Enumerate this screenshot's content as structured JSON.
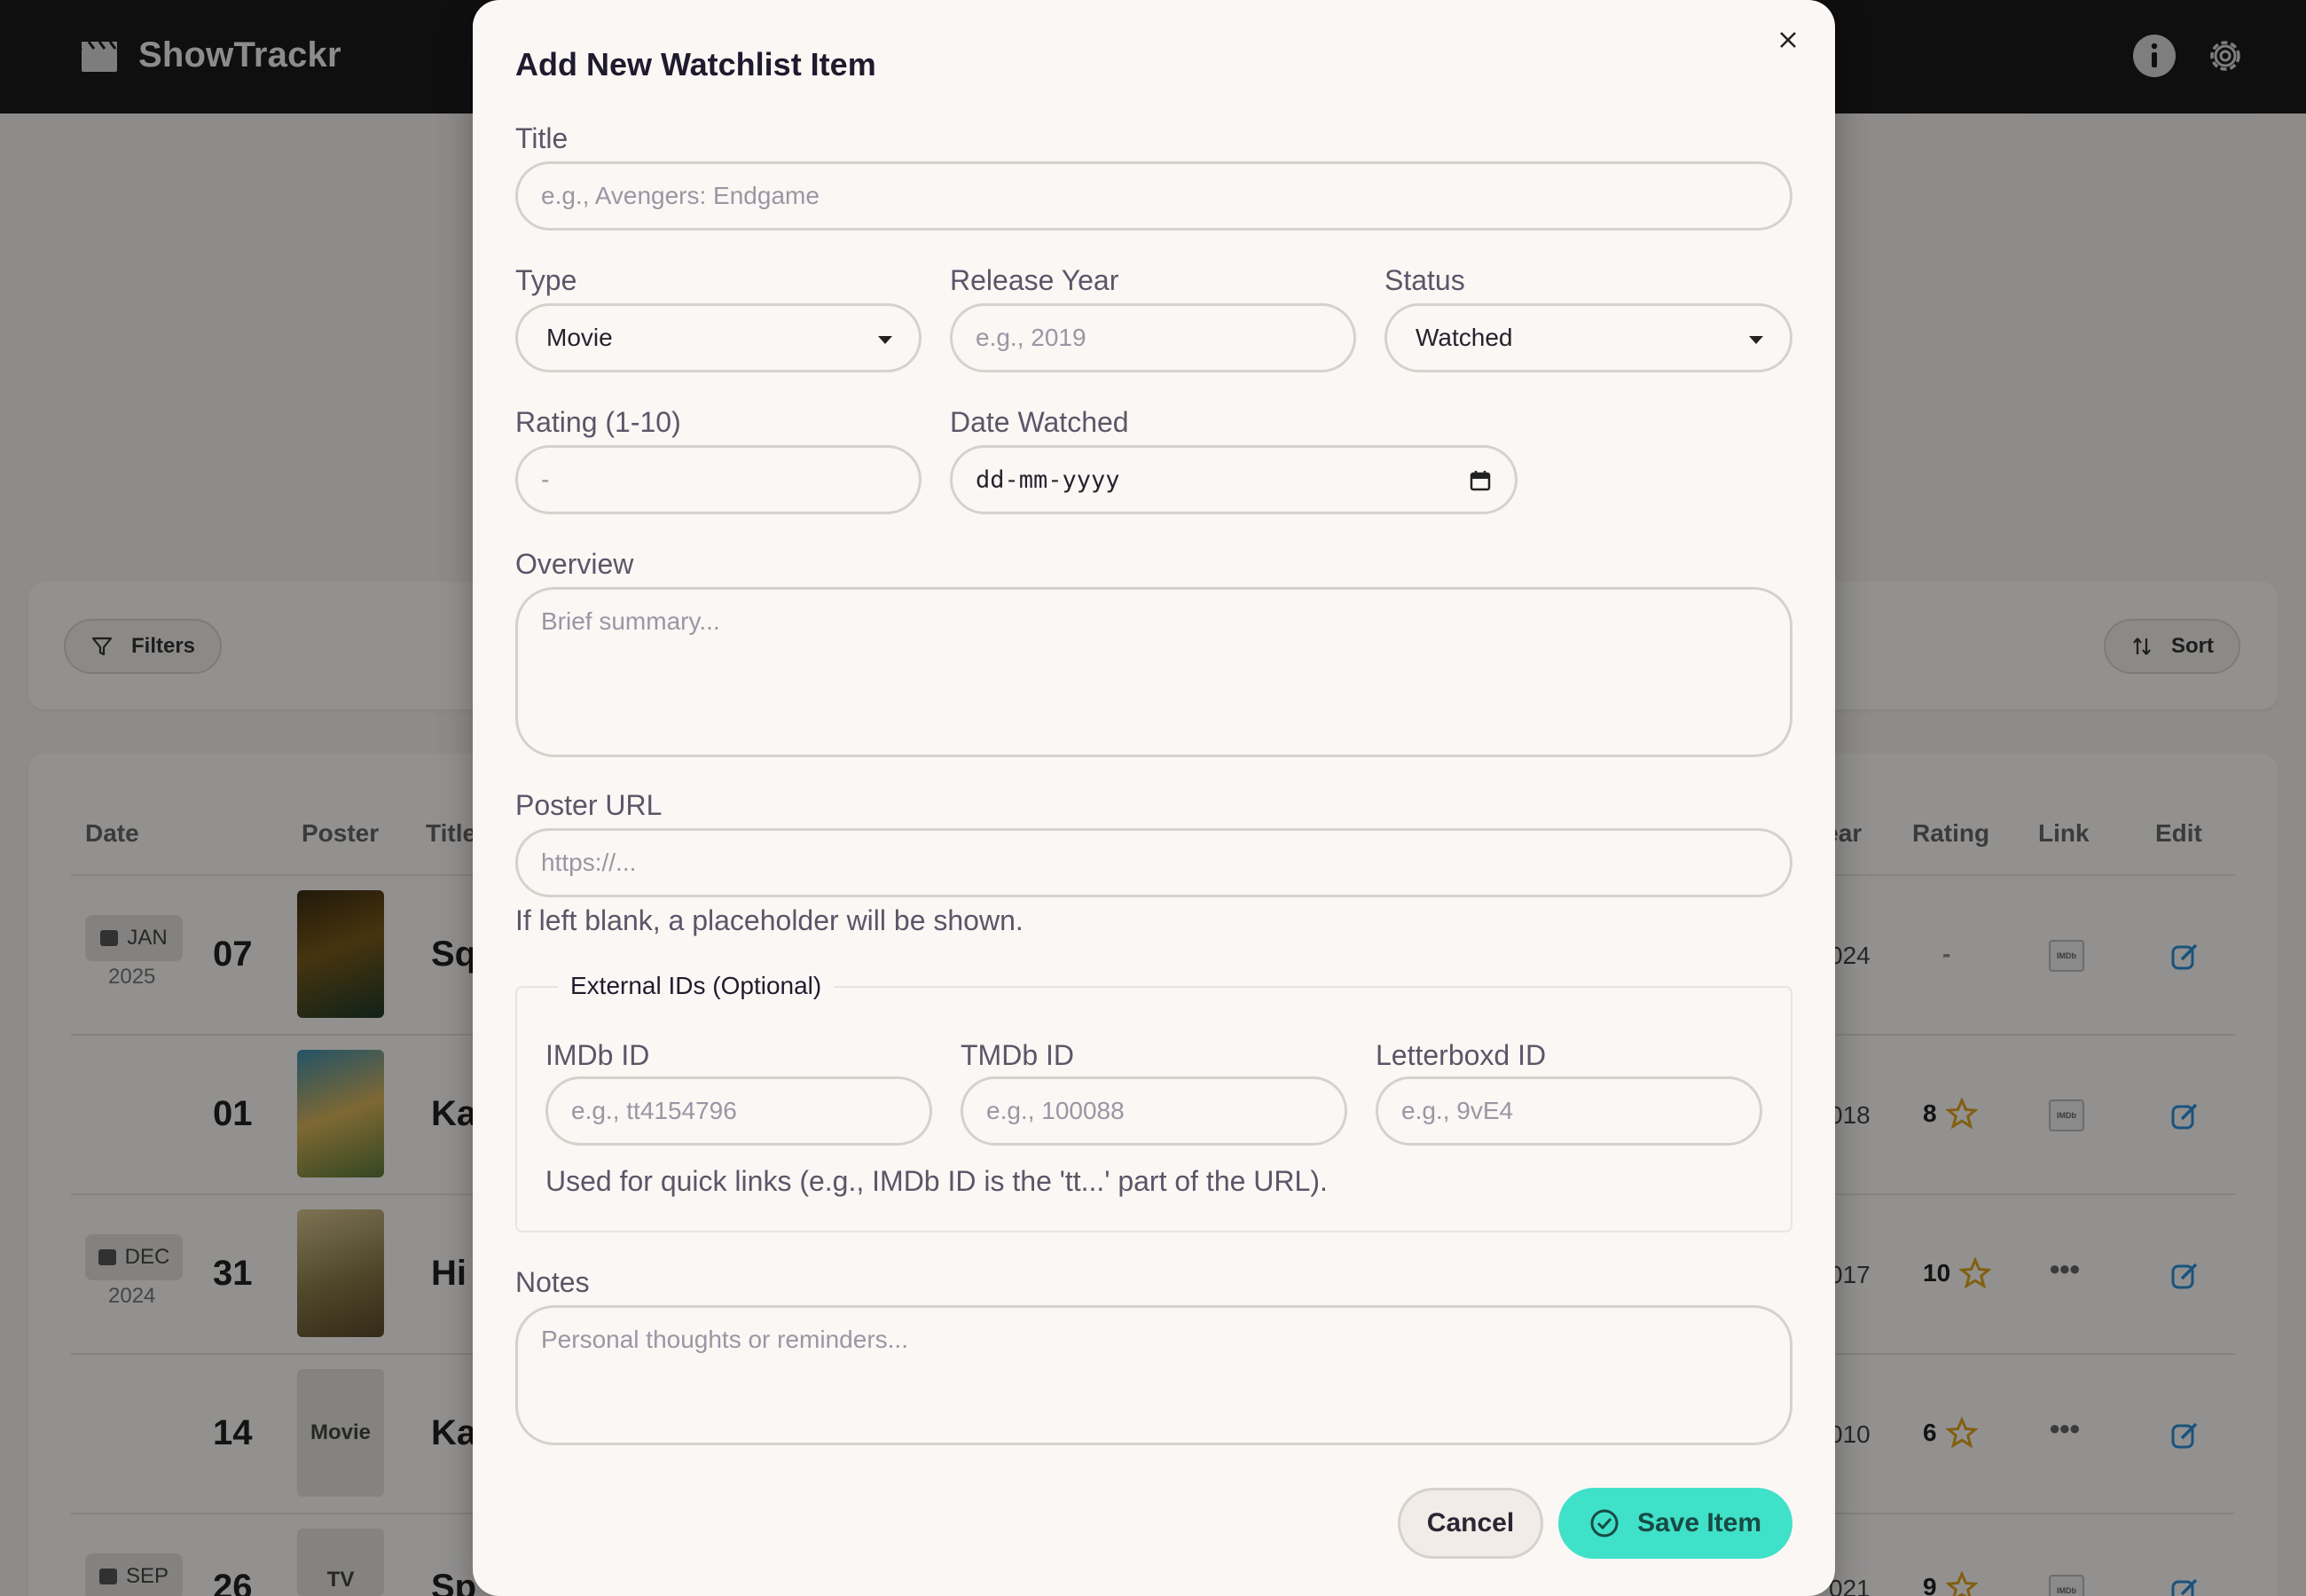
{
  "app": {
    "title": "ShowTrackr",
    "icons": [
      "clapperboard-icon",
      "info-icon",
      "gear-icon"
    ]
  },
  "toolbar": {
    "filters_label": "Filters",
    "sort_label": "Sort"
  },
  "table": {
    "headers": {
      "date": "Date",
      "poster": "Poster",
      "title": "Title",
      "year": "Year",
      "rating": "Rating",
      "link": "Link",
      "edit": "Edit"
    },
    "rows": [
      {
        "month": "JAN",
        "year": "2025",
        "day": "07",
        "title_fragment": "Sq",
        "year_fragment": "024",
        "rating": "-",
        "link": "IMDb",
        "poster": "image"
      },
      {
        "month": "",
        "year": "",
        "day": "01",
        "title_fragment": "Ka",
        "year_fragment": "018",
        "rating": "8",
        "link": "IMDb",
        "poster": "image"
      },
      {
        "month": "DEC",
        "year": "2024",
        "day": "31",
        "title_fragment": "Hi",
        "year_fragment": "017",
        "rating": "10",
        "link": "letterboxd",
        "poster": "image"
      },
      {
        "month": "",
        "year": "",
        "day": "14",
        "title_fragment": "Ka",
        "year_fragment": "010",
        "rating": "6",
        "link": "letterboxd",
        "poster": "Movie"
      },
      {
        "month": "SEP",
        "year": "",
        "day": "26",
        "title_fragment": "Sp",
        "year_fragment": "021",
        "rating": "9",
        "link": "IMDb",
        "poster": "TV"
      }
    ]
  },
  "modal": {
    "title": "Add New Watchlist Item",
    "fields": {
      "title": {
        "label": "Title",
        "placeholder": "e.g., Avengers: Endgame"
      },
      "type": {
        "label": "Type",
        "value": "Movie"
      },
      "release_year": {
        "label": "Release Year",
        "placeholder": "e.g., 2019"
      },
      "status": {
        "label": "Status",
        "value": "Watched"
      },
      "rating": {
        "label": "Rating (1-10)",
        "placeholder": "-"
      },
      "date_watched": {
        "label": "Date Watched",
        "value": "dd-mm-yyyy"
      },
      "overview": {
        "label": "Overview",
        "placeholder": "Brief summary..."
      },
      "poster_url": {
        "label": "Poster URL",
        "placeholder": "https://...",
        "hint": "If left blank, a placeholder will be shown."
      },
      "notes": {
        "label": "Notes",
        "placeholder": "Personal thoughts or reminders..."
      }
    },
    "external_ids": {
      "legend": "External IDs (Optional)",
      "imdb": {
        "label": "IMDb ID",
        "placeholder": "e.g., tt4154796"
      },
      "tmdb": {
        "label": "TMDb ID",
        "placeholder": "e.g., 100088"
      },
      "letterboxd": {
        "label": "Letterboxd ID",
        "placeholder": "e.g., 9vE4"
      },
      "hint": "Used for quick links (e.g., IMDb ID is the 'tt...' part of the URL)."
    },
    "buttons": {
      "cancel": "Cancel",
      "save": "Save Item"
    }
  },
  "colors": {
    "accent": "#3fe1c8",
    "topbar": "#1b1b1d",
    "link_blue": "#2e8fd6",
    "star": "#e0a21b"
  }
}
